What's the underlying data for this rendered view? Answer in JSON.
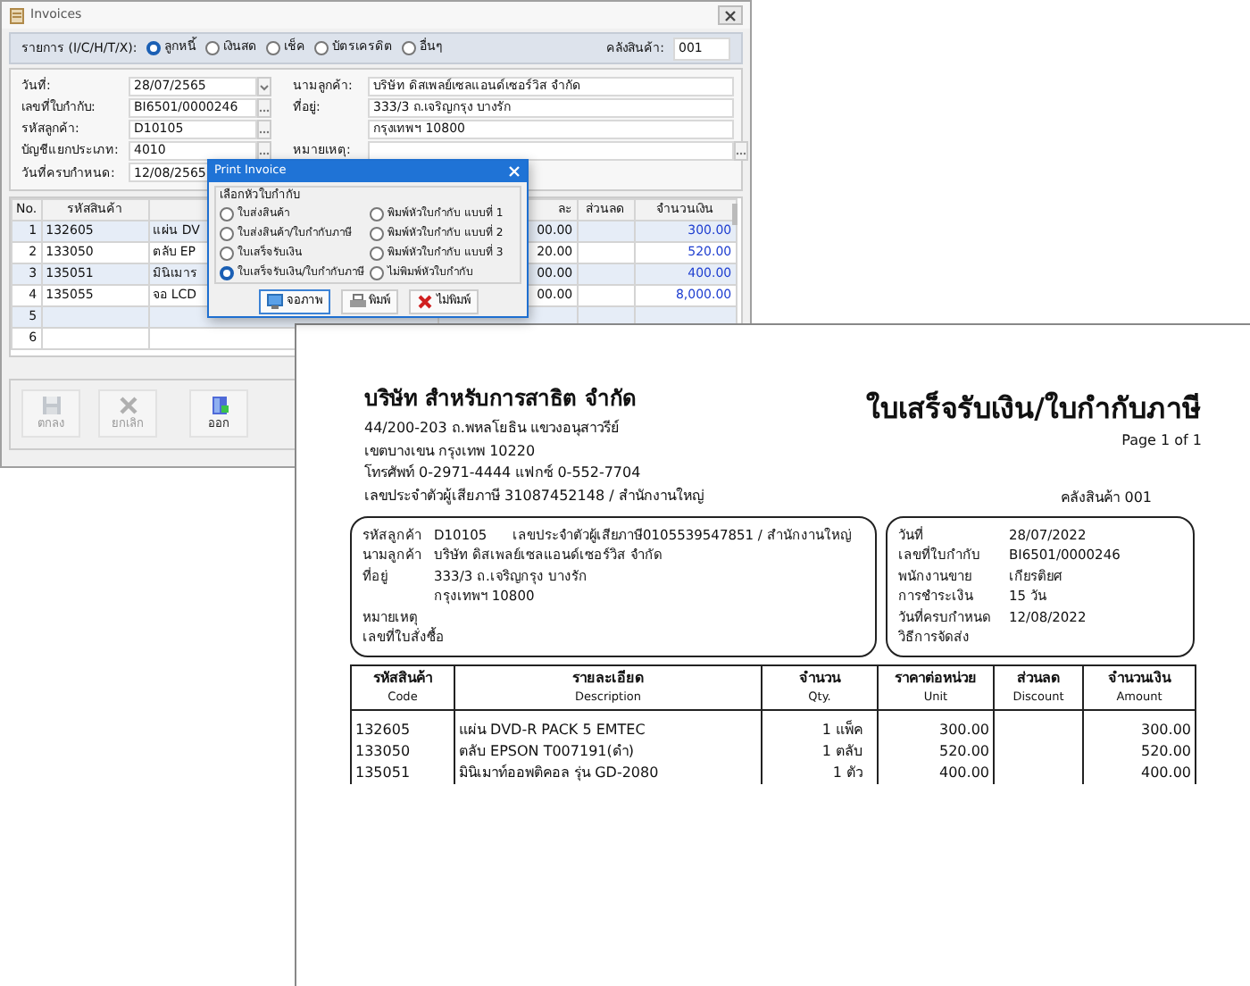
{
  "main_window": {
    "title": "Invoices",
    "type_label": "รายการ (I/C/H/T/X):",
    "types": [
      {
        "label": "ลูกหนี้",
        "selected": true
      },
      {
        "label": "เงินสด",
        "selected": false
      },
      {
        "label": "เช็ค",
        "selected": false
      },
      {
        "label": "บัตรเครดิต",
        "selected": false
      },
      {
        "label": "อื่นๆ",
        "selected": false
      }
    ],
    "warehouse_label": "คลังสินค้า:",
    "warehouse": "001",
    "fields_left": [
      {
        "label": "วันที่:",
        "value": "28/07/2565",
        "kind": "dropdown"
      },
      {
        "label": "เลขที่ใบกำกับ:",
        "value": "BI6501/0000246",
        "kind": "lookup"
      },
      {
        "label": "รหัสลูกค้า:",
        "value": "D10105",
        "kind": "lookup"
      },
      {
        "label": "บัญชีแยกประเภท:",
        "value": "4010",
        "kind": "lookup"
      },
      {
        "label": "วันที่ครบกำหนด:",
        "value": "12/08/2565",
        "kind": "text"
      }
    ],
    "fields_right": [
      {
        "label": "นามลูกค้า:",
        "value": "บริษัท ดิสเพลย์เซลแอนด์เซอร์วิส จำกัด",
        "kind": "text"
      },
      {
        "label": "ที่อยู่:",
        "value": "333/3 ถ.เจริญกรุง บางรัก",
        "kind": "text"
      },
      {
        "value": "กรุงเทพฯ 10800",
        "kind": "text"
      },
      {
        "label": "หมายเหตุ:",
        "kind": "lookup"
      }
    ],
    "grid": {
      "columns": [
        "No.",
        "รหัสสินค้า",
        "ละ",
        "ส่วนลด",
        "จำนวนเงิน"
      ],
      "rows": [
        {
          "no": "1",
          "code": "132605",
          "description": "แผ่น DV",
          "price": "00.00",
          "amount": "300.00"
        },
        {
          "no": "2",
          "code": "133050",
          "description": "ตลับ EP",
          "price": "20.00",
          "amount": "520.00"
        },
        {
          "no": "3",
          "code": "135051",
          "description": "มินิเมาร",
          "price": "00.00",
          "amount": "400.00"
        },
        {
          "no": "4",
          "code": "135055",
          "description": "จอ LCD",
          "price": "00.00",
          "amount": "8,000.00"
        },
        {
          "no": "5"
        },
        {
          "no": "6"
        }
      ]
    },
    "buttons": [
      {
        "label": "ตกลง",
        "kind": "save",
        "disabled": true
      },
      {
        "label": "ยกเลิก",
        "kind": "cancel",
        "disabled": true
      },
      {
        "label": "ออก",
        "kind": "exit",
        "disabled": false
      }
    ]
  },
  "print_dialog": {
    "title": "Print Invoice",
    "group_label": "เลือกหัวใบกำกับ",
    "options": [
      {
        "label": "ใบส่งสินค้า",
        "selected": false
      },
      {
        "label": "ใบส่งสินค้า/ใบกำกับภาษี",
        "selected": false
      },
      {
        "label": "ใบเสร็จรับเงิน",
        "selected": false
      },
      {
        "label": "ใบเสร็จรับเงิน/ใบกำกับภาษี",
        "selected": true
      },
      {
        "label": "พิมพ์หัวใบกำกับ แบบที่ 1",
        "selected": false
      },
      {
        "label": "พิมพ์หัวใบกำกับ แบบที่ 2",
        "selected": false
      },
      {
        "label": "พิมพ์หัวใบกำกับ แบบที่ 3",
        "selected": false
      },
      {
        "label": "ไม่พิมพ์หัวใบกำกับ",
        "selected": false
      }
    ],
    "buttons": [
      {
        "label": "จอภาพ",
        "kind": "screen"
      },
      {
        "label": "พิมพ์",
        "kind": "printer"
      },
      {
        "label": "ไม่พิมพ์",
        "kind": "cancel"
      }
    ]
  },
  "document": {
    "company": "บริษัท สำหรับการสาธิต จำกัด",
    "company_lines": [
      "44/200-203 ถ.พหลโยธิน แขวงอนุสาวรีย์",
      "เขตบางเขน กรุงเทพ 10220",
      "โทรศัพท์ 0-2971-4444 แฟกซ์ 0-552-7704",
      "เลขประจำตัวผู้เสียภาษี 31087452148   / สำนักงานใหญ่"
    ],
    "title": "ใบเสร็จรับเงิน/ใบกำกับภาษี",
    "page": "Page 1 of 1",
    "warehouse": "คลังสินค้า 001",
    "customer": [
      {
        "label": "รหัสลูกค้า",
        "value": "D10105",
        "extra": "เลขประจำตัวผู้เสียภาษี0105539547851 / สำนักงานใหญ่"
      },
      {
        "label": "นามลูกค้า",
        "value": "บริษัท ดิสเพลย์เซลแอนด์เซอร์วิส จำกัด"
      },
      {
        "label": "ที่อยู่",
        "value": "333/3 ถ.เจริญกรุง บางรัก"
      },
      {
        "value": "กรุงเทพฯ 10800"
      },
      {
        "label": "หมายเหตุ"
      },
      {
        "label": "เลขที่ใบสั่งซื้อ"
      }
    ],
    "invoice": [
      {
        "label": "วันที่",
        "value": "28/07/2022"
      },
      {
        "label": "เลขที่ใบกำกับ",
        "value": "BI6501/0000246"
      },
      {
        "label": "พนักงานขาย",
        "value": "เกียรติยศ"
      },
      {
        "label": "การชำระเงิน",
        "value": "15 วัน"
      },
      {
        "label": "วันที่ครบกำหนด",
        "value": "12/08/2022"
      },
      {
        "label": "วิธีการจัดส่ง"
      }
    ],
    "columns": [
      {
        "th": "รหัสสินค้า",
        "en": "Code"
      },
      {
        "th": "รายละเอียด",
        "en": "Description"
      },
      {
        "th": "จำนวน",
        "en": "Qty."
      },
      {
        "th": "ราคาต่อหน่วย",
        "en": "Unit"
      },
      {
        "th": "ส่วนลด",
        "en": "Discount"
      },
      {
        "th": "จำนวนเงิน",
        "en": "Amount"
      }
    ],
    "rows": [
      [
        "132605",
        "แผ่น DVD-R PACK 5 EMTEC",
        "1 แพ็ค",
        "300.00",
        "",
        "300.00"
      ],
      [
        "133050",
        "ตลับ EPSON T007191(ดำ)",
        "1 ตลับ",
        "520.00",
        "",
        "520.00"
      ],
      [
        "135051",
        "มินิเมาท์ออพติคอล รุ่น GD-2080",
        "1 ตัว",
        "400.00",
        "",
        "400.00"
      ]
    ]
  }
}
